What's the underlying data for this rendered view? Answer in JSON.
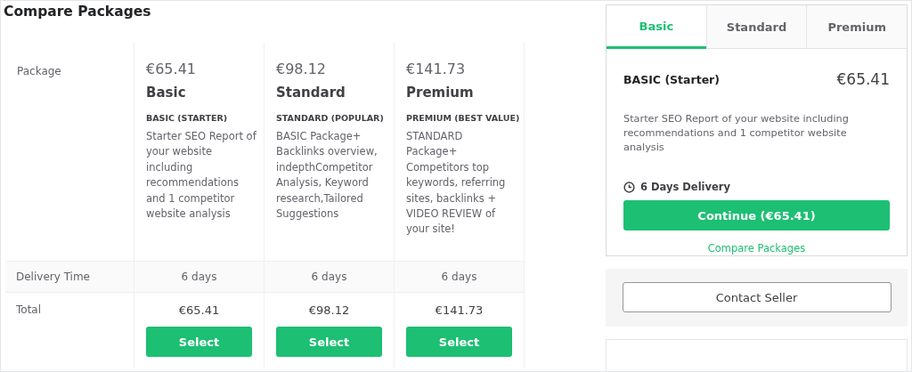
{
  "compare": {
    "title": "Compare Packages",
    "row_labels": {
      "package": "Package",
      "delivery": "Delivery Time",
      "total": "Total"
    },
    "packages": [
      {
        "price": "€65.41",
        "name": "Basic",
        "subtitle": "BASIC (STARTER)",
        "description": "Starter SEO Report of your website including recommendations and 1 competitor website analysis",
        "delivery": "6 days",
        "total": "€65.41",
        "button": "Select"
      },
      {
        "price": "€98.12",
        "name": "Standard",
        "subtitle": "STANDARD (POPULAR)",
        "description": "BASIC Package+ Backlinks overview, indepthCompetitor Analysis, Keyword research,Tailored Suggestions",
        "delivery": "6 days",
        "total": "€98.12",
        "button": "Select"
      },
      {
        "price": "€141.73",
        "name": "Premium",
        "subtitle": "PREMIUM (BEST VALUE)",
        "description": "STANDARD Package+ Competitors top keywords, referring sites, backlinks + VIDEO REVIEW of your site!",
        "delivery": "6 days",
        "total": "€141.73",
        "button": "Select"
      }
    ]
  },
  "sidebar": {
    "tabs": [
      {
        "label": "Basic",
        "selected": true
      },
      {
        "label": "Standard",
        "selected": false
      },
      {
        "label": "Premium",
        "selected": false
      }
    ],
    "package_title": "BASIC (Starter)",
    "price": "€65.41",
    "description": "Starter SEO Report of your website including recommendations and 1 competitor website analysis",
    "delivery": "6 Days Delivery",
    "continue_button": "Continue (€65.41)",
    "compare_link": "Compare Packages",
    "contact_button": "Contact Seller"
  }
}
